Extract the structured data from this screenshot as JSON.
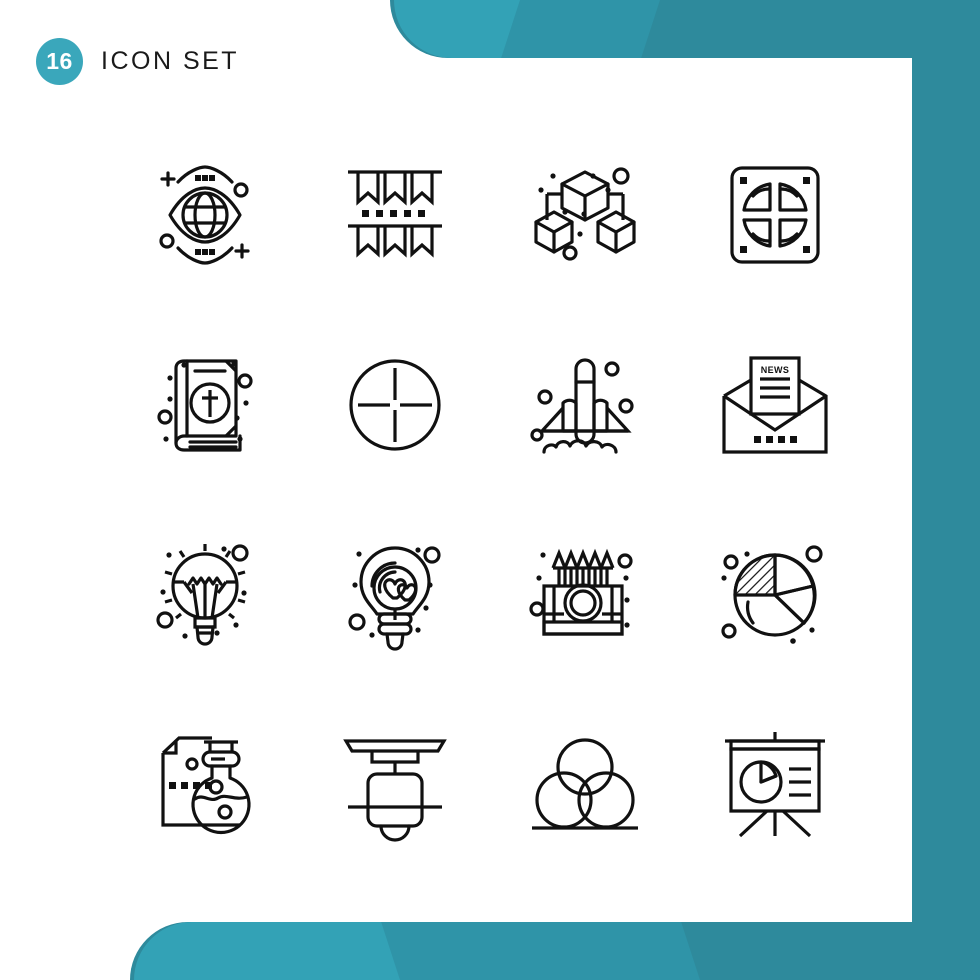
{
  "header": {
    "count": "16",
    "title": "Icon Set"
  },
  "theme": {
    "accent": "#3aa7bb",
    "accent_dark": "#2e8a9c",
    "accent_mid": "#2f94a8",
    "accent_light": "#33a2b6",
    "stroke": "#111111",
    "background": "#ffffff"
  },
  "grid": {
    "columns": 4,
    "rows": 4,
    "total": 16
  },
  "icons": [
    {
      "index": "1",
      "name": "global-vision-eye-icon",
      "label": "Global Vision"
    },
    {
      "index": "2",
      "name": "party-bunting-flags-icon",
      "label": "Bunting Flags"
    },
    {
      "index": "3",
      "name": "blockchain-cubes-icon",
      "label": "Blockchain"
    },
    {
      "index": "4",
      "name": "vent-grill-panel-icon",
      "label": "Vent Panel"
    },
    {
      "index": "5",
      "name": "holy-bible-book-icon",
      "label": "Holy Book"
    },
    {
      "index": "6",
      "name": "crosshair-target-icon",
      "label": "Crosshair"
    },
    {
      "index": "7",
      "name": "rocket-launch-icon",
      "label": "Rocket Launch"
    },
    {
      "index": "8",
      "name": "news-envelope-icon",
      "label": "Newsletter"
    },
    {
      "index": "9",
      "name": "light-bulb-idea-icon",
      "label": "Idea Bulb"
    },
    {
      "index": "10",
      "name": "love-idea-bulb-icon",
      "label": "Love Idea"
    },
    {
      "index": "11",
      "name": "color-pencils-box-icon",
      "label": "Pencil Box"
    },
    {
      "index": "12",
      "name": "pie-chart-icon",
      "label": "Pie Chart"
    },
    {
      "index": "13",
      "name": "lab-flask-document-icon",
      "label": "Lab Report"
    },
    {
      "index": "14",
      "name": "ceiling-projector-icon",
      "label": "Ceiling Projector"
    },
    {
      "index": "15",
      "name": "color-circles-venn-icon",
      "label": "Color Mixing"
    },
    {
      "index": "16",
      "name": "presentation-board-icon",
      "label": "Presentation"
    }
  ],
  "icon_text": {
    "news_label": "NEWS"
  }
}
